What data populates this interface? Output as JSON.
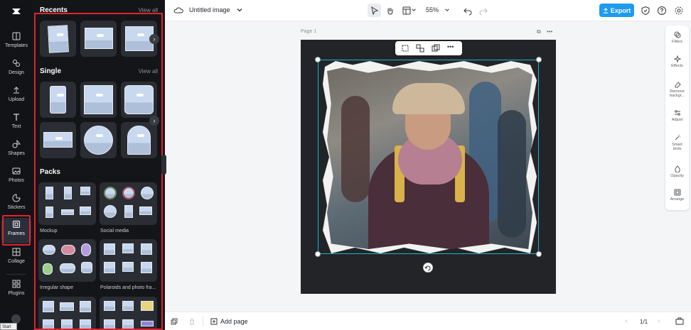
{
  "rail": {
    "items": [
      {
        "label": "Templates"
      },
      {
        "label": "Design"
      },
      {
        "label": "Upload"
      },
      {
        "label": "Text"
      },
      {
        "label": "Shapes"
      },
      {
        "label": "Photos"
      },
      {
        "label": "Stickers"
      },
      {
        "label": "Frames"
      },
      {
        "label": "Collage"
      },
      {
        "label": "Plugins"
      }
    ],
    "tooltip": "Start"
  },
  "panel": {
    "recents_title": "Recents",
    "single_title": "Single",
    "packs_title": "Packs",
    "view_all": "View all",
    "packs": [
      {
        "label": "Mockup"
      },
      {
        "label": "Social media"
      },
      {
        "label": "Irregular shape"
      },
      {
        "label": "Polaroids and photo fra..."
      }
    ]
  },
  "topbar": {
    "doc_title": "Untitled image",
    "zoom": "55%",
    "export_label": "Export"
  },
  "canvas": {
    "page_label": "Page 1"
  },
  "right_tools": [
    {
      "label": "Filters"
    },
    {
      "label": "Effects"
    },
    {
      "label": "Remove backgr..."
    },
    {
      "label": "Adjust"
    },
    {
      "label": "Smart tools"
    },
    {
      "label": "Opacity"
    },
    {
      "label": "Arrange"
    }
  ],
  "bottombar": {
    "add_page": "Add page",
    "page_count": "1/1"
  },
  "colors": {
    "accent": "#1d9bf0",
    "highlight": "#e0242e",
    "selection": "#20b3c7",
    "sidebar_bg": "#121317"
  }
}
